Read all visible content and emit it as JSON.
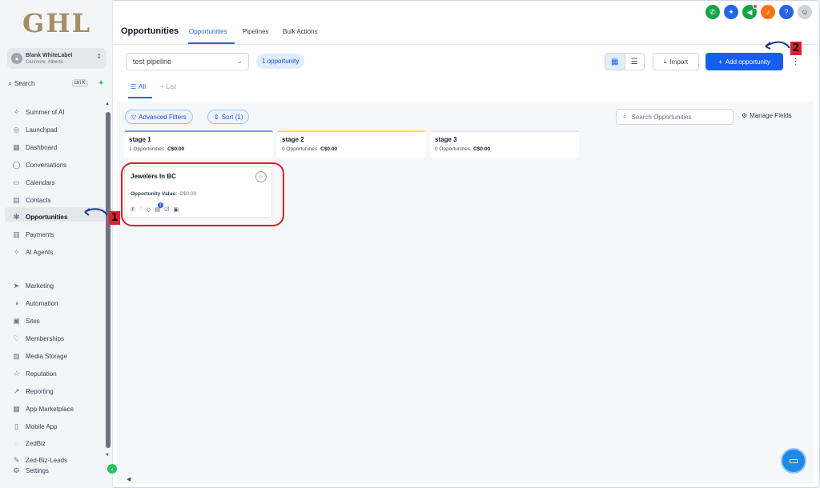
{
  "sidebar": {
    "logo": "GHL",
    "account": {
      "name": "Blank WhiteLabel",
      "location": "Canmore, Alberta"
    },
    "search": {
      "label": "Search",
      "shortcut": "ctrl K"
    },
    "items": [
      {
        "label": "Summer of AI",
        "icon": "sparkle-icon",
        "glyph": "✧"
      },
      {
        "label": "Launchpad",
        "icon": "rocket-icon",
        "glyph": "◎"
      },
      {
        "label": "Dashboard",
        "icon": "dashboard-icon",
        "glyph": "▦"
      },
      {
        "label": "Conversations",
        "icon": "chat-icon",
        "glyph": "◯"
      },
      {
        "label": "Calendars",
        "icon": "calendar-icon",
        "glyph": "▭"
      },
      {
        "label": "Contacts",
        "icon": "contacts-icon",
        "glyph": "▤"
      },
      {
        "label": "Opportunities",
        "icon": "opportunities-icon",
        "glyph": "✻"
      },
      {
        "label": "Payments",
        "icon": "payments-icon",
        "glyph": "▥"
      },
      {
        "label": "AI Agents",
        "icon": "ai-agents-icon",
        "glyph": "✧"
      },
      {
        "label": "Marketing",
        "icon": "send-icon",
        "glyph": "➤"
      },
      {
        "label": "Automation",
        "icon": "automation-icon",
        "glyph": "◑"
      },
      {
        "label": "Sites",
        "icon": "sites-icon",
        "glyph": "▣"
      },
      {
        "label": "Memberships",
        "icon": "membership-icon",
        "glyph": "♡"
      },
      {
        "label": "Media Storage",
        "icon": "media-icon",
        "glyph": "▨"
      },
      {
        "label": "Reputation",
        "icon": "star-icon",
        "glyph": "☆"
      },
      {
        "label": "Reporting",
        "icon": "trend-icon",
        "glyph": "↗"
      },
      {
        "label": "App Marketplace",
        "icon": "apps-icon",
        "glyph": "▦"
      },
      {
        "label": "Mobile App",
        "icon": "mobile-icon",
        "glyph": "▯"
      },
      {
        "label": "ZedBiz",
        "icon": "zedbiz-icon",
        "glyph": "◌"
      },
      {
        "label": "Zed-Biz-Leads",
        "icon": "wrench-icon",
        "glyph": "✎"
      },
      {
        "label": "Settings",
        "icon": "gear-icon",
        "glyph": "⚙"
      }
    ]
  },
  "header": {
    "title": "Opportunities",
    "tabs": [
      "Opportunities",
      "Pipelines",
      "Bulk Actions"
    ],
    "icons": [
      {
        "name": "phone-icon",
        "glyph": "✆",
        "color": "#16a34a"
      },
      {
        "name": "magic-icon",
        "glyph": "✦",
        "color": "#2563eb"
      },
      {
        "name": "megaphone-icon",
        "glyph": "◀",
        "color": "#16a34a"
      },
      {
        "name": "bell-icon",
        "glyph": "♪",
        "color": "#f97316"
      },
      {
        "name": "help-icon",
        "glyph": "?",
        "color": "#2563eb"
      }
    ]
  },
  "toolbar": {
    "pipeline": "test pipeline",
    "count": "1 opportunity",
    "import": "Import",
    "add": "Add opportunity"
  },
  "views": {
    "all": "All",
    "list": "List"
  },
  "filters": {
    "advanced": "Advanced Filters",
    "sort": "Sort (1)",
    "search_placeholder": "Search Opportunities",
    "manage": "Manage Fields"
  },
  "stages": [
    {
      "name": "stage 1",
      "count": "1 Opportunities",
      "value": "C$0.00",
      "color": "#60a5fa"
    },
    {
      "name": "stage 2",
      "count": "0 Opportunities",
      "value": "C$0.00",
      "color": "#fde047"
    },
    {
      "name": "stage 3",
      "count": "0 Opportunities",
      "value": "C$0.00",
      "color": "#e5e7eb"
    }
  ],
  "card": {
    "title": "Jewelers In BC",
    "value_label": "Opportunity Value:",
    "value": "C$0.00",
    "task_badge": "1"
  },
  "annotations": [
    "1",
    "2"
  ]
}
